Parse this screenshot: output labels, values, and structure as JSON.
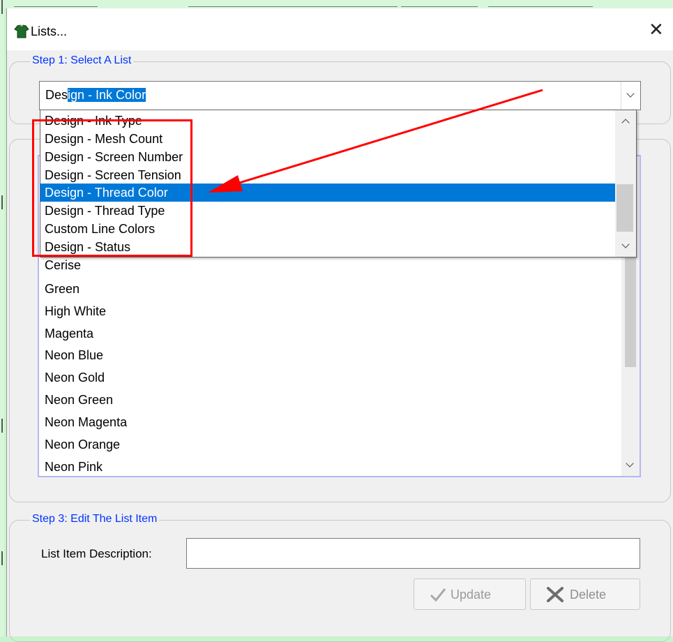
{
  "window": {
    "title": "Lists...",
    "close_glyph": "✕",
    "app_icon": "green-shirt-icon"
  },
  "step1": {
    "legend": "Step 1: Select A List",
    "combo_prefix": "Des",
    "combo_selected": "ign - Ink Color",
    "dropdown_items": [
      "Design - Ink Type",
      "Design - Mesh Count",
      "Design - Screen Number",
      "Design - Screen Tension",
      "Design - Thread Color",
      "Design - Thread Type",
      "Custom Line Colors",
      "Design - Status"
    ],
    "highlighted_index": 4
  },
  "step2": {
    "items": [
      "Cerise",
      "Green",
      "High White",
      "Magenta",
      "Neon Blue",
      "Neon Gold",
      "Neon Green",
      "Neon Magenta",
      "Neon Orange",
      "Neon Pink"
    ]
  },
  "step3": {
    "legend": "Step 3: Edit The List Item",
    "description_label": "List Item Description:",
    "description_value": "",
    "update_label": "Update",
    "delete_label": "Delete"
  },
  "colors": {
    "legend_blue": "#0033ff",
    "selection_blue": "#0078d7",
    "annotation_red": "#ff0000",
    "background_green": "#c8f3cc"
  }
}
